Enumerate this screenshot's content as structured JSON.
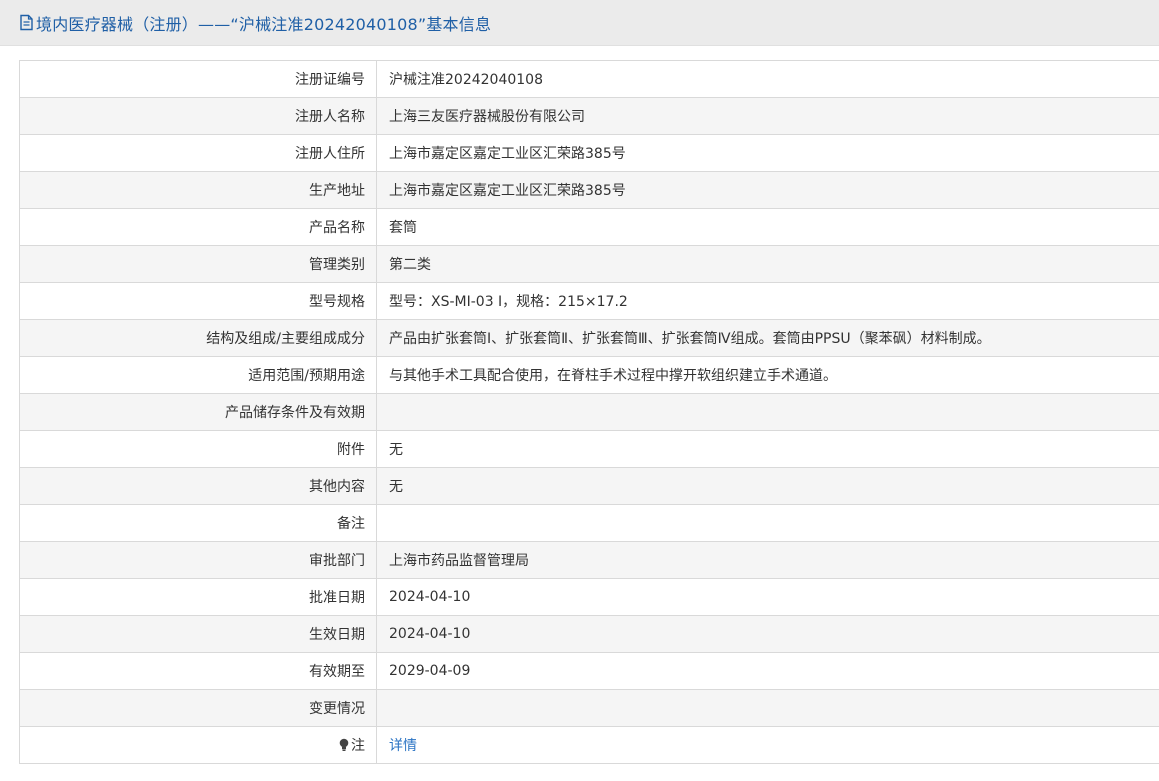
{
  "header": {
    "icon": "document-icon",
    "title": "境内医疗器械（注册）——“沪械注准20242040108”基本信息"
  },
  "rows": [
    {
      "label": "注册证编号",
      "value": "沪械注准20242040108"
    },
    {
      "label": "注册人名称",
      "value": "上海三友医疗器械股份有限公司"
    },
    {
      "label": "注册人住所",
      "value": "上海市嘉定区嘉定工业区汇荣路385号"
    },
    {
      "label": "生产地址",
      "value": "上海市嘉定区嘉定工业区汇荣路385号"
    },
    {
      "label": "产品名称",
      "value": "套筒"
    },
    {
      "label": "管理类别",
      "value": "第二类"
    },
    {
      "label": "型号规格",
      "value": "型号：XS-MI-03 I，规格：215×17.2"
    },
    {
      "label": "结构及组成/主要组成成分",
      "value": "产品由扩张套筒Ⅰ、扩张套筒Ⅱ、扩张套筒Ⅲ、扩张套筒Ⅳ组成。套筒由PPSU（聚苯砜）材料制成。"
    },
    {
      "label": "适用范围/预期用途",
      "value": "与其他手术工具配合使用，在脊柱手术过程中撑开软组织建立手术通道。"
    },
    {
      "label": "产品储存条件及有效期",
      "value": ""
    },
    {
      "label": "附件",
      "value": "无"
    },
    {
      "label": "其他内容",
      "value": "无"
    },
    {
      "label": "备注",
      "value": ""
    },
    {
      "label": "审批部门",
      "value": "上海市药品监督管理局"
    },
    {
      "label": "批准日期",
      "value": "2024-04-10"
    },
    {
      "label": "生效日期",
      "value": "2024-04-10"
    },
    {
      "label": "有效期至",
      "value": "2029-04-09"
    },
    {
      "label": "变更情况",
      "value": ""
    }
  ],
  "note_row": {
    "icon": "lightbulb-icon",
    "label": "注",
    "link_text": "详情"
  },
  "colors": {
    "header_bg": "#ebebeb",
    "title_blue": "#1f5fa6",
    "link_blue": "#2a73c4",
    "row_alt": "#f5f5f5",
    "border": "#d9d9d9"
  }
}
